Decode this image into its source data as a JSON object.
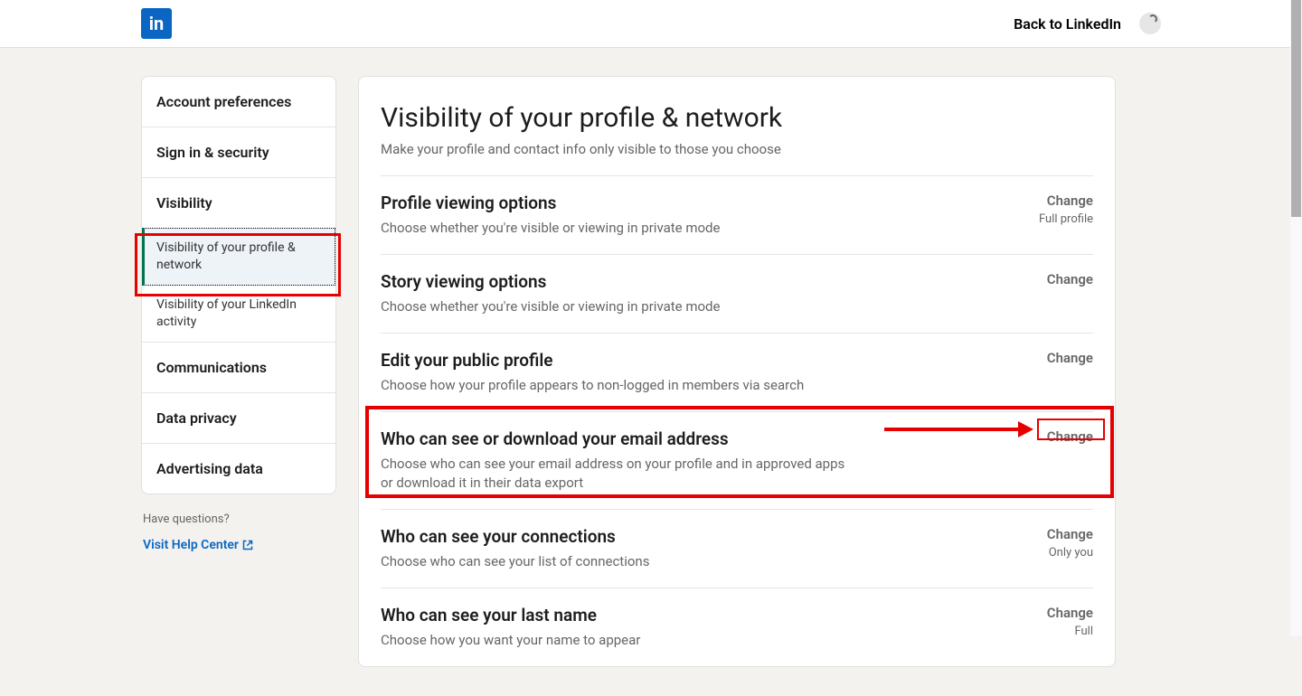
{
  "header": {
    "back_label": "Back to LinkedIn"
  },
  "sidebar": {
    "items": [
      {
        "label": "Account preferences"
      },
      {
        "label": "Sign in & security"
      },
      {
        "label": "Visibility"
      },
      {
        "label": "Communications"
      },
      {
        "label": "Data privacy"
      },
      {
        "label": "Advertising data"
      }
    ],
    "subitems": [
      {
        "label": "Visibility of your profile & network"
      },
      {
        "label": "Visibility of your LinkedIn activity"
      }
    ],
    "footer_question": "Have questions?",
    "help_link": "Visit Help Center"
  },
  "main": {
    "title": "Visibility of your profile & network",
    "subtitle": "Make your profile and contact info only visible to those you choose",
    "settings": [
      {
        "title": "Profile viewing options",
        "desc": "Choose whether you're visible or viewing in private mode",
        "change": "Change",
        "value": "Full profile"
      },
      {
        "title": "Story viewing options",
        "desc": "Choose whether you're visible or viewing in private mode",
        "change": "Change",
        "value": ""
      },
      {
        "title": "Edit your public profile",
        "desc": "Choose how your profile appears to non-logged in members via search",
        "change": "Change",
        "value": ""
      },
      {
        "title": "Who can see or download your email address",
        "desc": "Choose who can see your email address on your profile and in approved apps or download it in their data export",
        "change": "Change",
        "value": ""
      },
      {
        "title": "Who can see your connections",
        "desc": "Choose who can see your list of connections",
        "change": "Change",
        "value": "Only you"
      },
      {
        "title": "Who can see your last name",
        "desc": "Choose how you want your name to appear",
        "change": "Change",
        "value": "Full"
      }
    ]
  }
}
